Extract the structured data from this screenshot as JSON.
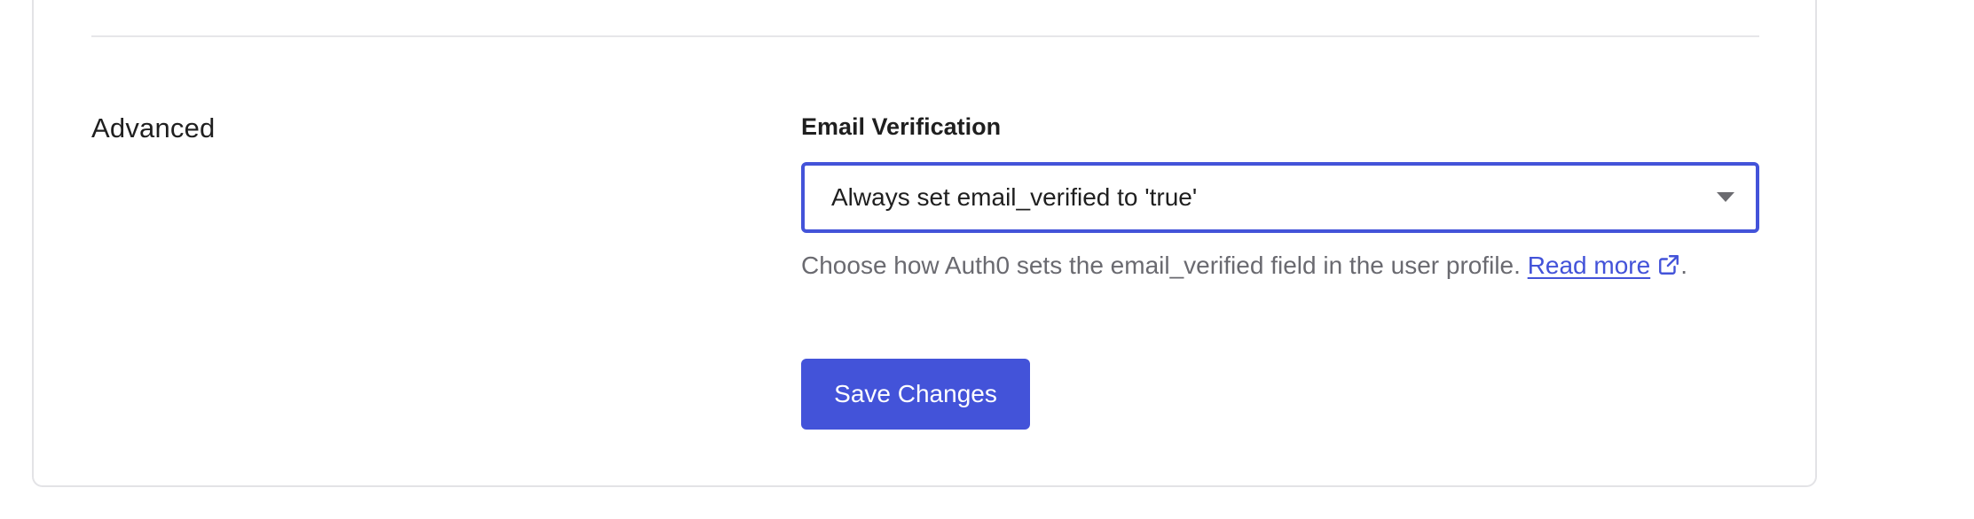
{
  "section": {
    "title": "Advanced"
  },
  "email_verification": {
    "label": "Email Verification",
    "selected_value": "Always set email_verified to 'true'",
    "help_text": "Choose how Auth0 sets the email_verified field in the user profile. ",
    "read_more_label": "Read more",
    "trailing": "."
  },
  "actions": {
    "save_label": "Save Changes"
  },
  "colors": {
    "accent": "#4353d9",
    "muted_text": "#6a6a70",
    "border": "#e3e3e6"
  }
}
